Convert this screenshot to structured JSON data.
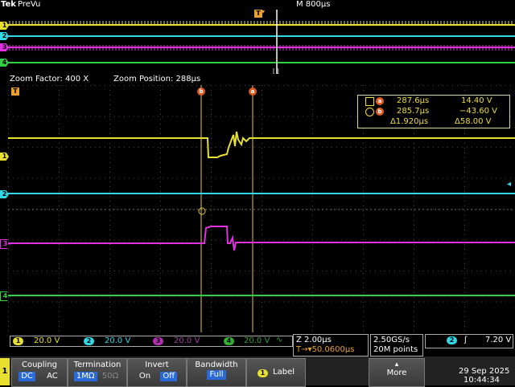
{
  "header": {
    "brand": "Tek",
    "mode": "PreVu",
    "timebase": "M 800µs"
  },
  "overview": {
    "trigger_marker": "T",
    "expand_marker": "[ ]",
    "channels": [
      "1",
      "2",
      "3",
      "4"
    ]
  },
  "zoom": {
    "factor_label": "Zoom Factor: 400 X",
    "position_label": "Zoom Position: 288µs",
    "trigger_marker": "T",
    "cursor_a_label": "a",
    "cursor_b_label": "b",
    "channel_markers": [
      "1",
      "2",
      "3",
      "4"
    ]
  },
  "readout": {
    "a_time": "287.6µs",
    "a_volt": "14.40 V",
    "b_time": "285.7µs",
    "b_volt": "−43.60 V",
    "delta_time": "Δ1.920µs",
    "delta_volt": "Δ58.00 V",
    "a_tag": "a",
    "b_tag": "b"
  },
  "status": {
    "ch1": {
      "num": "1",
      "scale": "20.0 V"
    },
    "ch2": {
      "num": "2",
      "scale": "20.0 V"
    },
    "ch3": {
      "num": "3",
      "scale": "20.0 V"
    },
    "ch4": {
      "num": "4",
      "scale": "20.0 V",
      "coupling_icon": "∿"
    },
    "horizontal": {
      "zoom_scale": "Z 2.00µs",
      "trigger_pos": "T→▾50.0600µs"
    },
    "acq": {
      "rate": "2.50GS/s",
      "points": "20M points"
    },
    "trigger": {
      "src": "2",
      "slope": "ʃ",
      "level": "7.20 V"
    }
  },
  "menu": {
    "channel_tab": "1",
    "coupling": {
      "title": "Coupling",
      "opt1": "DC",
      "opt2": "AC"
    },
    "termination": {
      "title": "Termination",
      "opt1": "1MΩ",
      "opt2": "50Ω"
    },
    "invert": {
      "title": "Invert",
      "opt1": "On",
      "opt2": "Off"
    },
    "bandwidth": {
      "title": "Bandwidth",
      "value": "Full"
    },
    "label": {
      "num": "1",
      "title": "Label"
    },
    "more": {
      "title": "More"
    },
    "date": "29 Sep 2025",
    "time": "10:44:34"
  },
  "colors": {
    "ch1": "#e8e030",
    "ch2": "#30d8e8",
    "ch3": "#e030e0",
    "ch4": "#30d040",
    "grid": "#3a3a3a",
    "cursor": "#e8c830",
    "cursor_b": "#e05a20",
    "select": "#2a6ad8"
  }
}
